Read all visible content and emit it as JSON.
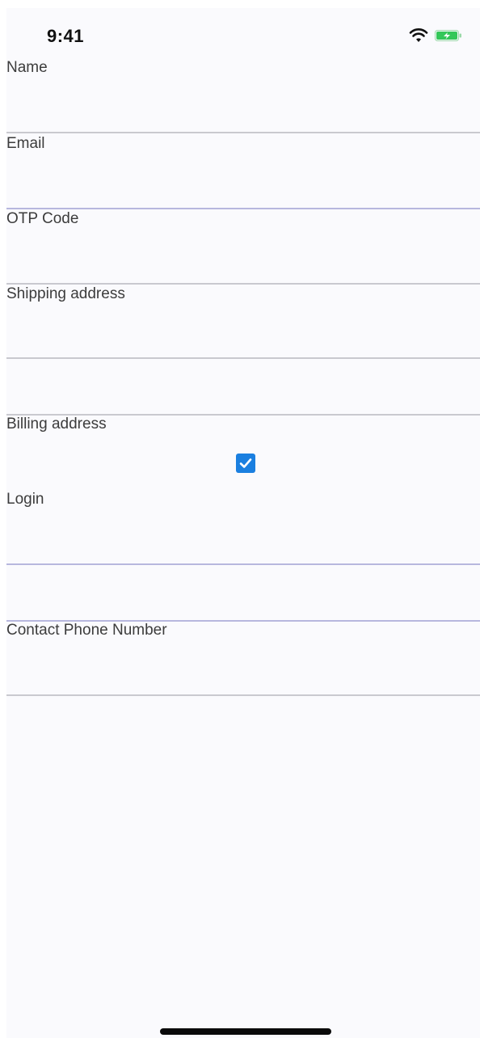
{
  "status_bar": {
    "time": "9:41",
    "wifi_icon": "wifi-icon",
    "battery_icon": "battery-charging-icon",
    "battery_color": "#34c759"
  },
  "form": {
    "name_label": "Name",
    "email_label": "Email",
    "otp_label": "OTP Code",
    "shipping_label": "Shipping address",
    "billing_label": "Billing address",
    "billing_checkbox_checked": true,
    "login_label": "Login",
    "phone_label": "Contact Phone Number"
  },
  "colors": {
    "background": "#fafafd",
    "checkbox": "#1a7fe0",
    "divider": "#c9c9cf",
    "focused_divider": "#b7b7de"
  }
}
